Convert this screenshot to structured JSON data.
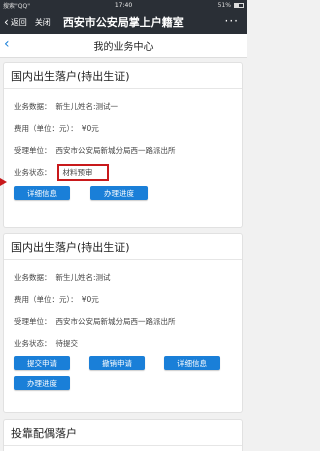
{
  "status_bar": {
    "carrier": "搜索\"QQ\"",
    "time": "17:40",
    "battery": "51%"
  },
  "wechat_bar": {
    "back_label": "返回",
    "close_label": "关闭",
    "title": "西安市公安局掌上户籍室"
  },
  "page": {
    "title": "我的业务中心"
  },
  "cards": [
    {
      "title": "国内出生落户(持出生证)",
      "rows": [
        {
          "key": "业务数据：",
          "value": "新生儿姓名:测试一"
        },
        {
          "key": "费用（单位：元）：",
          "value": "¥0元"
        },
        {
          "key": "受理单位：",
          "value": "西安市公安局新城分局西一路派出所"
        },
        {
          "key": "业务状态：",
          "value": "材料预审"
        }
      ],
      "buttons": [
        "详细信息",
        "办理进度"
      ]
    },
    {
      "title": "国内出生落户(持出生证)",
      "rows": [
        {
          "key": "业务数据：",
          "value": "新生儿姓名:测试"
        },
        {
          "key": "费用（单位：元）：",
          "value": "¥0元"
        },
        {
          "key": "受理单位：",
          "value": "西安市公安局新城分局西一路派出所"
        },
        {
          "key": "业务状态：",
          "value": "待提交"
        }
      ],
      "buttons": [
        "提交申请",
        "撤销申请",
        "详细信息",
        "办理进度"
      ]
    },
    {
      "title": "投靠配偶落户"
    }
  ],
  "colors": {
    "accent": "#1a7fd8",
    "highlight": "#c8191b",
    "header_bg": "#2a2f36"
  }
}
